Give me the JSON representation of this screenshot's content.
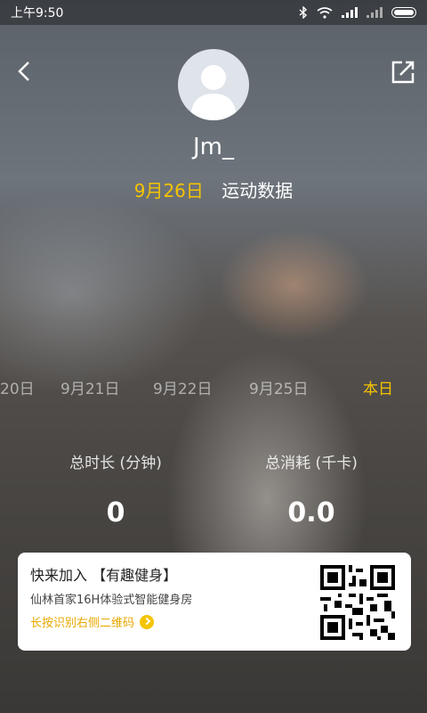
{
  "status_bar": {
    "time": "上午9:50"
  },
  "profile": {
    "username": "Jm_"
  },
  "header": {
    "date": "9月26日",
    "title": "运动数据"
  },
  "day_tabs": [
    "20日",
    "9月21日",
    "9月22日",
    "9月25日",
    "本日"
  ],
  "stats": {
    "duration_label": "总时长 (分钟)",
    "duration_value": "0",
    "calories_label": "总消耗 (千卡)",
    "calories_value": "0.0"
  },
  "promo": {
    "title": "快来加入 【有趣健身】",
    "description": "仙林首家16H体验式智能健身房",
    "link": "长按识别右侧二维码"
  }
}
